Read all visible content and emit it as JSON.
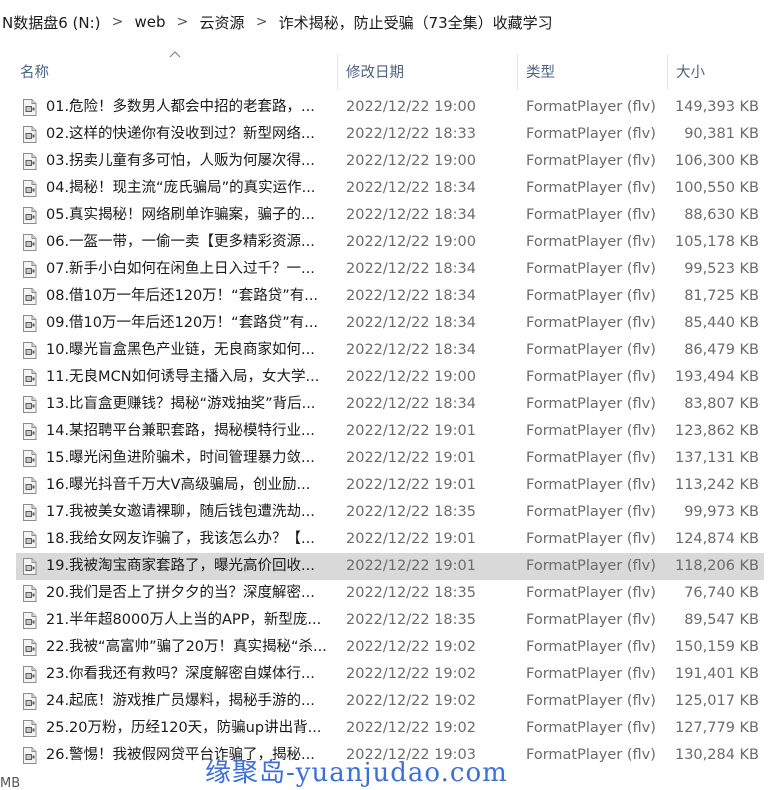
{
  "breadcrumb": {
    "items": [
      "N数据盘6 (N:)",
      "web",
      "云资源",
      "诈术揭秘，防止受骗（73全集）收藏学习"
    ],
    "separator": ">"
  },
  "columns": {
    "name": "名称",
    "date": "修改日期",
    "type": "类型",
    "size": "大小"
  },
  "files": [
    {
      "name": "01.危险！多数男人都会中招的老套路，...",
      "date": "2022/12/22 19:00",
      "type": "FormatPlayer (flv)",
      "size": "149,393 KB"
    },
    {
      "name": "02.这样的快递你有没收到过？新型网络...",
      "date": "2022/12/22 18:33",
      "type": "FormatPlayer (flv)",
      "size": "90,381 KB"
    },
    {
      "name": "03.拐卖儿童有多可怕，人贩为何屡次得...",
      "date": "2022/12/22 19:00",
      "type": "FormatPlayer (flv)",
      "size": "106,300 KB"
    },
    {
      "name": "04.揭秘！现主流“庞氏骗局”的真实运作...",
      "date": "2022/12/22 18:34",
      "type": "FormatPlayer (flv)",
      "size": "100,550 KB"
    },
    {
      "name": "05.真实揭秘！网络刷单诈骗案，骗子的...",
      "date": "2022/12/22 18:34",
      "type": "FormatPlayer (flv)",
      "size": "88,630 KB"
    },
    {
      "name": "06.一盔一带，一偷一卖【更多精彩资源...",
      "date": "2022/12/22 19:00",
      "type": "FormatPlayer (flv)",
      "size": "105,178 KB"
    },
    {
      "name": "07.新手小白如何在闲鱼上日入过千？一...",
      "date": "2022/12/22 18:34",
      "type": "FormatPlayer (flv)",
      "size": "99,523 KB"
    },
    {
      "name": "08.借10万一年后还120万！“套路贷”有...",
      "date": "2022/12/22 18:34",
      "type": "FormatPlayer (flv)",
      "size": "81,725 KB"
    },
    {
      "name": "09.借10万一年后还120万！“套路贷”有...",
      "date": "2022/12/22 18:34",
      "type": "FormatPlayer (flv)",
      "size": "85,440 KB"
    },
    {
      "name": "10.曝光盲盒黑色产业链，无良商家如何...",
      "date": "2022/12/22 18:34",
      "type": "FormatPlayer (flv)",
      "size": "86,479 KB"
    },
    {
      "name": "11.无良MCN如何诱导主播入局，女大学...",
      "date": "2022/12/22 19:00",
      "type": "FormatPlayer (flv)",
      "size": "193,494 KB"
    },
    {
      "name": "13.比盲盒更赚钱？揭秘“游戏抽奖”背后...",
      "date": "2022/12/22 18:34",
      "type": "FormatPlayer (flv)",
      "size": "83,807 KB"
    },
    {
      "name": "14.某招聘平台兼职套路，揭秘模特行业...",
      "date": "2022/12/22 19:01",
      "type": "FormatPlayer (flv)",
      "size": "123,862 KB"
    },
    {
      "name": "15.曝光闲鱼进阶骗术，时间管理暴力敛...",
      "date": "2022/12/22 19:01",
      "type": "FormatPlayer (flv)",
      "size": "137,131 KB"
    },
    {
      "name": "16.曝光抖音千万大V高级骗局，创业励...",
      "date": "2022/12/22 19:01",
      "type": "FormatPlayer (flv)",
      "size": "113,242 KB"
    },
    {
      "name": "17.我被美女邀请裸聊，随后钱包遭洗劫...",
      "date": "2022/12/22 18:35",
      "type": "FormatPlayer (flv)",
      "size": "99,973 KB"
    },
    {
      "name": "18.我给女网友诈骗了，我该怎么办？【...",
      "date": "2022/12/22 19:01",
      "type": "FormatPlayer (flv)",
      "size": "124,874 KB"
    },
    {
      "name": "19.我被淘宝商家套路了，曝光高价回收...",
      "date": "2022/12/22 19:01",
      "type": "FormatPlayer (flv)",
      "size": "118,206 KB",
      "selected": true
    },
    {
      "name": "20.我们是否上了拼夕夕的当？深度解密...",
      "date": "2022/12/22 18:35",
      "type": "FormatPlayer (flv)",
      "size": "76,740 KB"
    },
    {
      "name": "21.半年超8000万人上当的APP，新型庞...",
      "date": "2022/12/22 18:35",
      "type": "FormatPlayer (flv)",
      "size": "89,547 KB"
    },
    {
      "name": "22.我被“高富帅”骗了20万！真实揭秘“杀...",
      "date": "2022/12/22 19:02",
      "type": "FormatPlayer (flv)",
      "size": "150,159 KB"
    },
    {
      "name": "23.你看我还有救吗？深度解密自媒体行...",
      "date": "2022/12/22 19:02",
      "type": "FormatPlayer (flv)",
      "size": "191,401 KB"
    },
    {
      "name": "24.起底！游戏推广员爆料，揭秘手游的...",
      "date": "2022/12/22 19:02",
      "type": "FormatPlayer (flv)",
      "size": "125,017 KB"
    },
    {
      "name": "25.20万粉，历经120天，防骗up讲出背...",
      "date": "2022/12/22 19:02",
      "type": "FormatPlayer (flv)",
      "size": "127,779 KB"
    },
    {
      "name": "26.警惕！我被假网贷平台诈骗了，揭秘...",
      "date": "2022/12/22 19:03",
      "type": "FormatPlayer (flv)",
      "size": "130,284 KB"
    }
  ],
  "bottom_partial": "MB",
  "watermark": "缘聚岛-yuanjudao.com",
  "icon": "flv-file-icon",
  "colors": {
    "header_text": "#4d6584",
    "selected_row": "#d9d9d9",
    "secondary_text": "#6b6b6b",
    "watermark": "#2c64d6"
  }
}
